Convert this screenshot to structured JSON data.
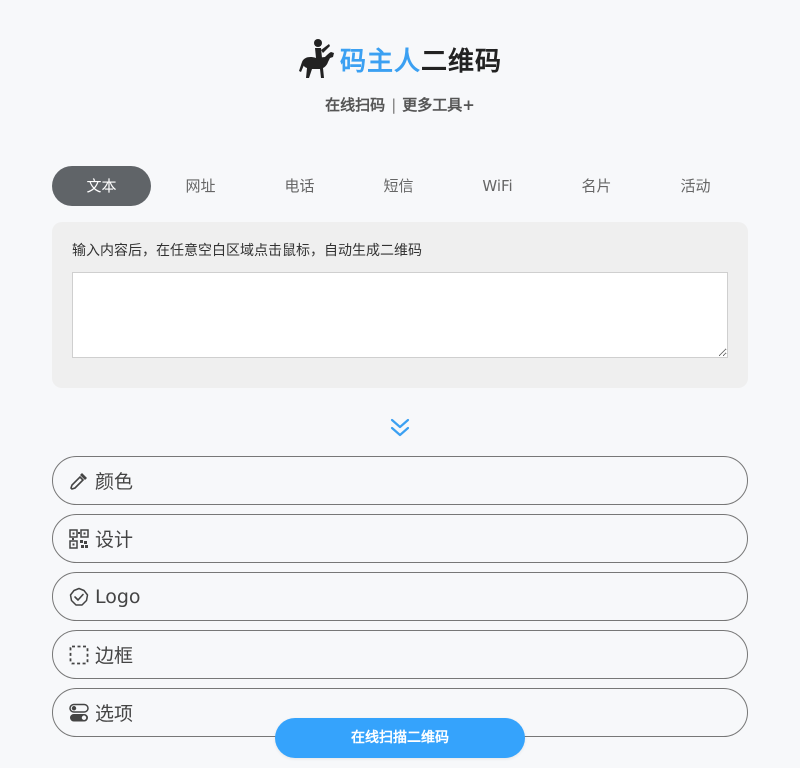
{
  "brand": {
    "part1": "码主人",
    "part2": "二维码",
    "icon": "horse-rider-icon"
  },
  "sublinks": {
    "scan": "在线扫码",
    "separator": "|",
    "more": "更多工具+"
  },
  "tabs": [
    {
      "label": "文本",
      "active": true
    },
    {
      "label": "网址",
      "active": false
    },
    {
      "label": "电话",
      "active": false
    },
    {
      "label": "短信",
      "active": false
    },
    {
      "label": "WiFi",
      "active": false
    },
    {
      "label": "名片",
      "active": false
    },
    {
      "label": "活动",
      "active": false
    }
  ],
  "input": {
    "hint": "输入内容后，在任意空白区域点击鼠标，自动生成二维码",
    "value": "",
    "placeholder": ""
  },
  "sections": [
    {
      "label": "颜色",
      "icon": "eyedropper-icon"
    },
    {
      "label": "设计",
      "icon": "qr-pattern-icon"
    },
    {
      "label": "Logo",
      "icon": "badge-check-icon"
    },
    {
      "label": "边框",
      "icon": "dashed-frame-icon"
    },
    {
      "label": "选项",
      "icon": "toggles-icon"
    }
  ],
  "scan_button": {
    "label": "在线扫描二维码"
  },
  "colors": {
    "accent": "#3ba0f2",
    "tab_active_bg": "#606468",
    "button_bg": "#35a3fc",
    "panel_bg": "#efefef",
    "page_bg": "#f7f8fa"
  }
}
